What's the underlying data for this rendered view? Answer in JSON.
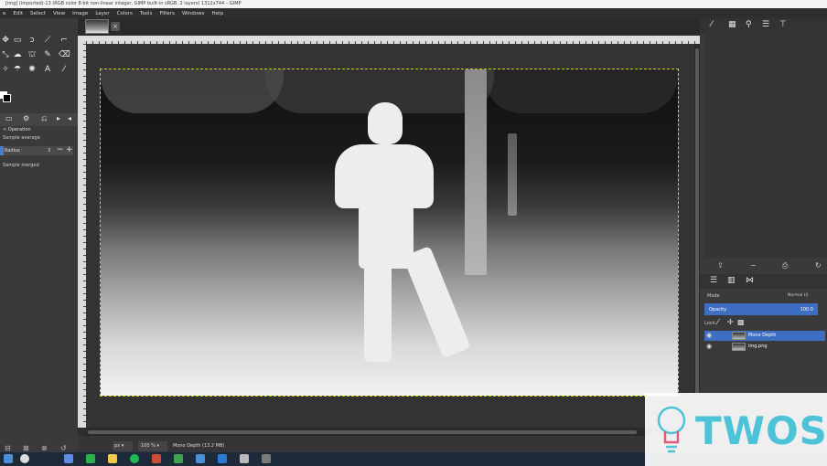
{
  "title": "[img] (imported)-13 (RGB color 8-bit non-linear integer, GIMP built-in sRGB, 2 layers) 1312x744 – GIMP",
  "menu": [
    "e",
    "Edit",
    "Select",
    "View",
    "Image",
    "Layer",
    "Colors",
    "Tools",
    "Filters",
    "Windows",
    "Help"
  ],
  "tool_options": {
    "title": "< Operation",
    "sample_average": "Sample average",
    "radius_label": "Radius",
    "radius_value": "3",
    "minus": "−",
    "plus": "+",
    "sample_merged": "Sample merged"
  },
  "status": {
    "unit": "px",
    "zoom": "100 %",
    "text": "Mono Depth (13.2 MB)"
  },
  "layers_panel": {
    "mode_label": "Mode",
    "mode_value": "Normal (l)",
    "opacity_label": "Opacity",
    "opacity_value": "100.0",
    "lock_label": "Lock:",
    "layers": [
      {
        "name": "Mono Depth",
        "selected": true
      },
      {
        "name": "img.png",
        "selected": false
      }
    ]
  },
  "watermark": "TWOS",
  "colors": {
    "accent": "#3d6ec2",
    "watermark": "#4cc3d9",
    "selection_outline": "#d6d600"
  }
}
